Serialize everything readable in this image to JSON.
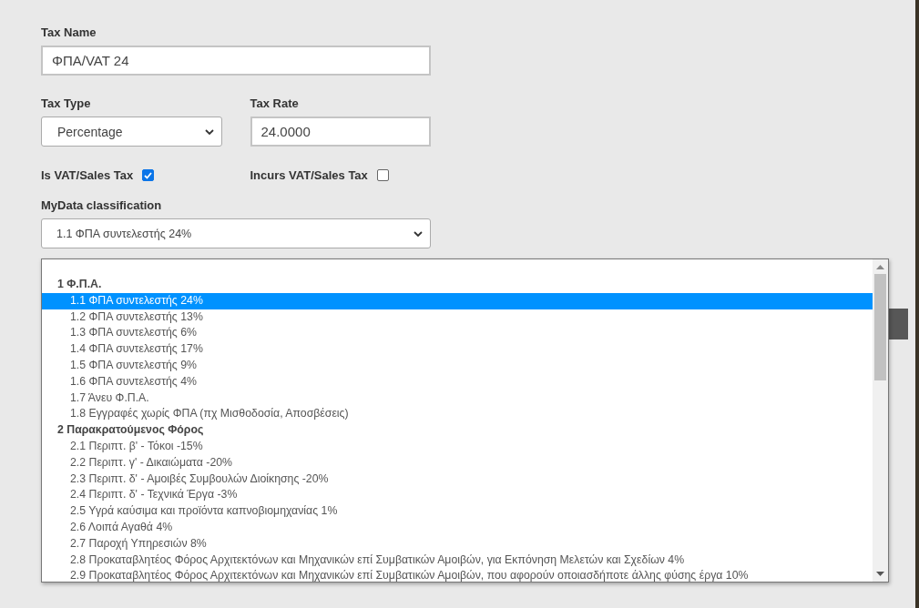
{
  "tax_name": {
    "label": "Tax Name",
    "value": "ΦΠΑ/VAT 24"
  },
  "tax_type": {
    "label": "Tax Type",
    "value": "Percentage"
  },
  "tax_rate": {
    "label": "Tax Rate",
    "value": "24.0000"
  },
  "checkboxes": [
    {
      "label": "Is VAT/Sales Tax",
      "checked": true
    },
    {
      "label": "Incurs VAT/Sales Tax",
      "checked": false
    }
  ],
  "mydata": {
    "label": "MyData classification",
    "value": "1.1 ΦΠΑ συντελεστής 24%",
    "options": [
      {
        "label": "1 Φ.Π.Α.",
        "children": [
          {
            "label": "1.1 ΦΠΑ συντελεστής 24%",
            "selected": true
          },
          {
            "label": "1.2 ΦΠΑ συντελεστής 13%",
            "selected": false
          },
          {
            "label": "1.3 ΦΠΑ συντελεστής 6%",
            "selected": false
          },
          {
            "label": "1.4 ΦΠΑ συντελεστής 17%",
            "selected": false
          },
          {
            "label": "1.5 ΦΠΑ συντελεστής 9%",
            "selected": false
          },
          {
            "label": "1.6 ΦΠΑ συντελεστής 4%",
            "selected": false
          },
          {
            "label": "1.7 Άνευ Φ.Π.Α.",
            "selected": false
          },
          {
            "label": "1.8 Εγγραφές χωρίς ΦΠΑ (πχ Μισθοδοσία, Αποσβέσεις)",
            "selected": false
          }
        ]
      },
      {
        "label": "2 Παρακρατούμενος Φόρος",
        "children": [
          {
            "label": "2.1 Περιπτ. β' - Τόκοι -15%",
            "selected": false
          },
          {
            "label": "2.2 Περιπτ. γ' - Δικαιώματα -20%",
            "selected": false
          },
          {
            "label": "2.3 Περιπτ. δ' - Αμοιβές Συμβουλών Διοίκησης -20%",
            "selected": false
          },
          {
            "label": "2.4 Περιπτ. δ' - Τεχνικά Έργα -3%",
            "selected": false
          },
          {
            "label": "2.5 Υγρά καύσιμα και προϊόντα καπνοβιομηχανίας 1%",
            "selected": false
          },
          {
            "label": "2.6 Λοιπά Αγαθά 4%",
            "selected": false
          },
          {
            "label": "2.7 Παροχή Υπηρεσιών 8%",
            "selected": false
          },
          {
            "label": "2.8 Προκαταβλητέος Φόρος Αρχιτεκτόνων και Μηχανικών επί Συμβατικών Αμοιβών, για Εκπόνηση Μελετών και Σχεδίων 4%",
            "selected": false
          },
          {
            "label": "2.9 Προκαταβλητέος Φόρος Αρχιτεκτόνων και Μηχανικών επί Συμβατικών Αμοιβών, που αφορούν οποιασδήποτε άλλης φύσης έργα 10%",
            "selected": false
          }
        ]
      }
    ]
  }
}
